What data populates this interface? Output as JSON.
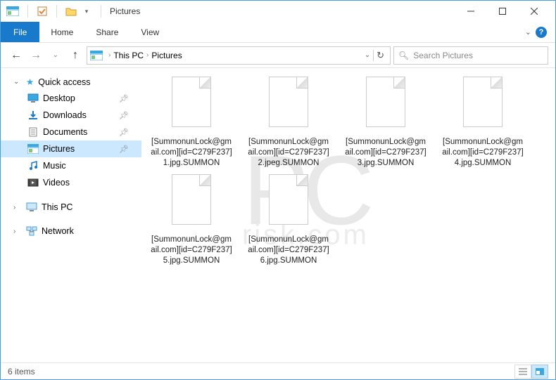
{
  "window": {
    "title": "Pictures",
    "quickAccessChecked": true
  },
  "ribbon": {
    "file": "File",
    "tabs": [
      "Home",
      "Share",
      "View"
    ]
  },
  "breadcrumb": {
    "items": [
      "This PC",
      "Pictures"
    ],
    "searchPlaceholder": "Search Pictures"
  },
  "navPane": {
    "quickAccess": {
      "label": "Quick access",
      "items": [
        {
          "label": "Desktop",
          "icon": "desktop",
          "pinned": true
        },
        {
          "label": "Downloads",
          "icon": "downloads",
          "pinned": true
        },
        {
          "label": "Documents",
          "icon": "documents",
          "pinned": true
        },
        {
          "label": "Pictures",
          "icon": "pictures",
          "pinned": true,
          "selected": true
        },
        {
          "label": "Music",
          "icon": "music",
          "pinned": false
        },
        {
          "label": "Videos",
          "icon": "videos",
          "pinned": false
        }
      ]
    },
    "thisPC": {
      "label": "This PC"
    },
    "network": {
      "label": "Network"
    }
  },
  "files": [
    {
      "name": "[SummonunLock@gmail.com][id=C279F237]1.jpg.SUMMON"
    },
    {
      "name": "[SummonunLock@gmail.com][id=C279F237]2.jpeg.SUMMON"
    },
    {
      "name": "[SummonunLock@gmail.com][id=C279F237]3.jpg.SUMMON"
    },
    {
      "name": "[SummonunLock@gmail.com][id=C279F237]4.jpg.SUMMON"
    },
    {
      "name": "[SummonunLock@gmail.com][id=C279F237]5.jpg.SUMMON"
    },
    {
      "name": "[SummonunLock@gmail.com][id=C279F237]6.jpg.SUMMON"
    }
  ],
  "statusBar": {
    "itemCount": "6 items"
  },
  "watermark": {
    "main": "PC",
    "sub": "risk.com"
  }
}
